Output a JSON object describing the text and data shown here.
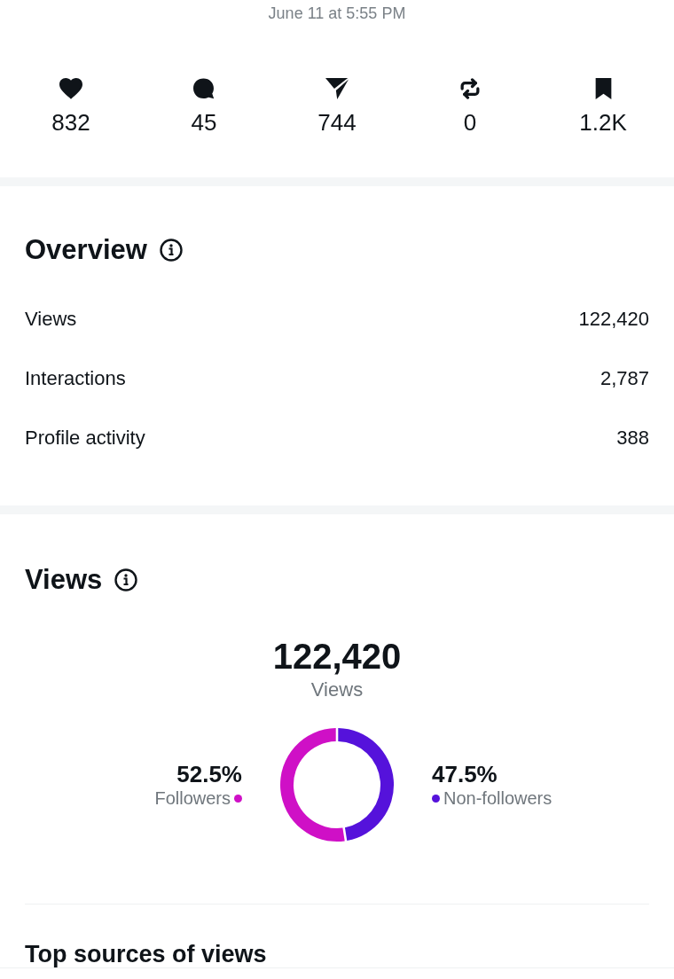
{
  "timestamp": "June 11 at 5:55 PM",
  "engagement": [
    {
      "kind": "likes",
      "count": "832"
    },
    {
      "kind": "replies",
      "count": "45"
    },
    {
      "kind": "shares",
      "count": "744"
    },
    {
      "kind": "reposts",
      "count": "0"
    },
    {
      "kind": "bookmarks",
      "count": "1.2K"
    }
  ],
  "overview": {
    "title": "Overview",
    "rows": [
      {
        "label": "Views",
        "value": "122,420"
      },
      {
        "label": "Interactions",
        "value": "2,787"
      },
      {
        "label": "Profile activity",
        "value": "388"
      }
    ]
  },
  "views": {
    "title": "Views",
    "total": "122,420",
    "caption": "Views",
    "legend": [
      {
        "value": "52.5%",
        "color": "#cf10c6"
      },
      {
        "value": "47.5%",
        "color": "#5512db"
      }
    ],
    "chart_data": {
      "type": "donut",
      "categories": [
        "Followers",
        "Non-followers"
      ],
      "values": [
        52.5,
        47.5
      ]
    }
  },
  "top_sources": {
    "title": "Top sources of views"
  }
}
